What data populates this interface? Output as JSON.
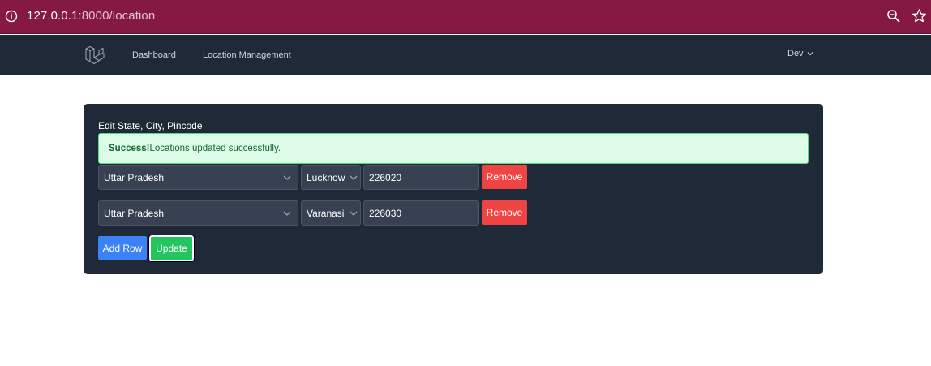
{
  "browser": {
    "url_host": "127.0.0.1",
    "url_rest": ":8000/location"
  },
  "nav": {
    "links": [
      "Dashboard",
      "Location Management"
    ],
    "user": "Dev"
  },
  "card": {
    "title": "Edit State, City, Pincode",
    "alert": {
      "strong": "Success!",
      "message": "Locations updated successfully."
    },
    "rows": [
      {
        "state": "Uttar Pradesh",
        "city": "Lucknow",
        "pincode": "226020",
        "remove_label": "Remove"
      },
      {
        "state": "Uttar Pradesh",
        "city": "Varanasi",
        "pincode": "226030",
        "remove_label": "Remove"
      }
    ],
    "add_row_label": "Add Row",
    "update_label": "Update"
  },
  "colors": {
    "browser_bar": "#7d1a45",
    "navbar": "#1f2937",
    "card": "#1f2937",
    "alert_bg": "#dcfce7",
    "remove": "#ef4444",
    "add": "#3b82f6",
    "update": "#22c55e"
  },
  "icons": [
    "info-icon",
    "zoom-icon",
    "star-icon",
    "laravel-logo",
    "chevron-down-icon"
  ]
}
